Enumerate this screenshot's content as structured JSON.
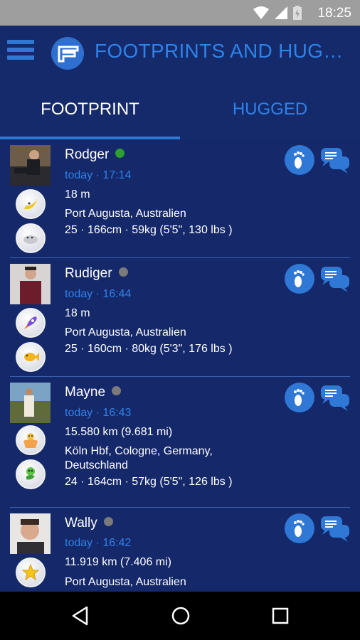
{
  "status_bar": {
    "time": "18:25",
    "icons": [
      "wifi-icon",
      "signal-icon",
      "battery-charging-icon"
    ]
  },
  "app_bar": {
    "title": "FOOTPRINTS AND HUGGED",
    "menu_icon": "hamburger-menu-icon",
    "logo": "app-logo"
  },
  "tabs": [
    {
      "label": "FOOTPRINT",
      "selected": true
    },
    {
      "label": "HUGGED",
      "selected": false
    }
  ],
  "colors": {
    "online": "#2ca02c",
    "offline": "#7a7a7a",
    "accent": "#2f82e8"
  },
  "users": [
    {
      "name": "Rodger",
      "online": true,
      "time": "today · 17:14",
      "distance": "18 m",
      "location": "Port Augusta, Australien",
      "stats": "25 · 166cm · 59kg (5'5\", 130 lbs )",
      "badges": [
        "banana-badge",
        "seal-badge"
      ]
    },
    {
      "name": "Rudiger",
      "online": false,
      "time": "today · 16:44",
      "distance": "18 m",
      "location": "Port Augusta, Australien",
      "stats": "25 · 160cm · 80kg (5'3\", 176 lbs )",
      "badges": [
        "rocket-badge",
        "fish-badge"
      ]
    },
    {
      "name": "Mayne",
      "online": false,
      "time": "today · 16:43",
      "distance": "15.580 km (9.681 mi)",
      "location": "Köln Hbf, Cologne, Germany, Deutschland",
      "stats": "24 · 164cm · 57kg (5'5\", 126 lbs )",
      "badges": [
        "muscle-man-badge",
        "snake-badge"
      ]
    },
    {
      "name": "Wally",
      "online": false,
      "time": "today · 16:42",
      "distance": "11.919 km (7.406 mi)",
      "location": "Port Augusta, Australien",
      "stats": "",
      "badges": [
        "star-badge"
      ]
    }
  ],
  "nav_bar": [
    "back-icon",
    "home-icon",
    "recents-icon"
  ]
}
